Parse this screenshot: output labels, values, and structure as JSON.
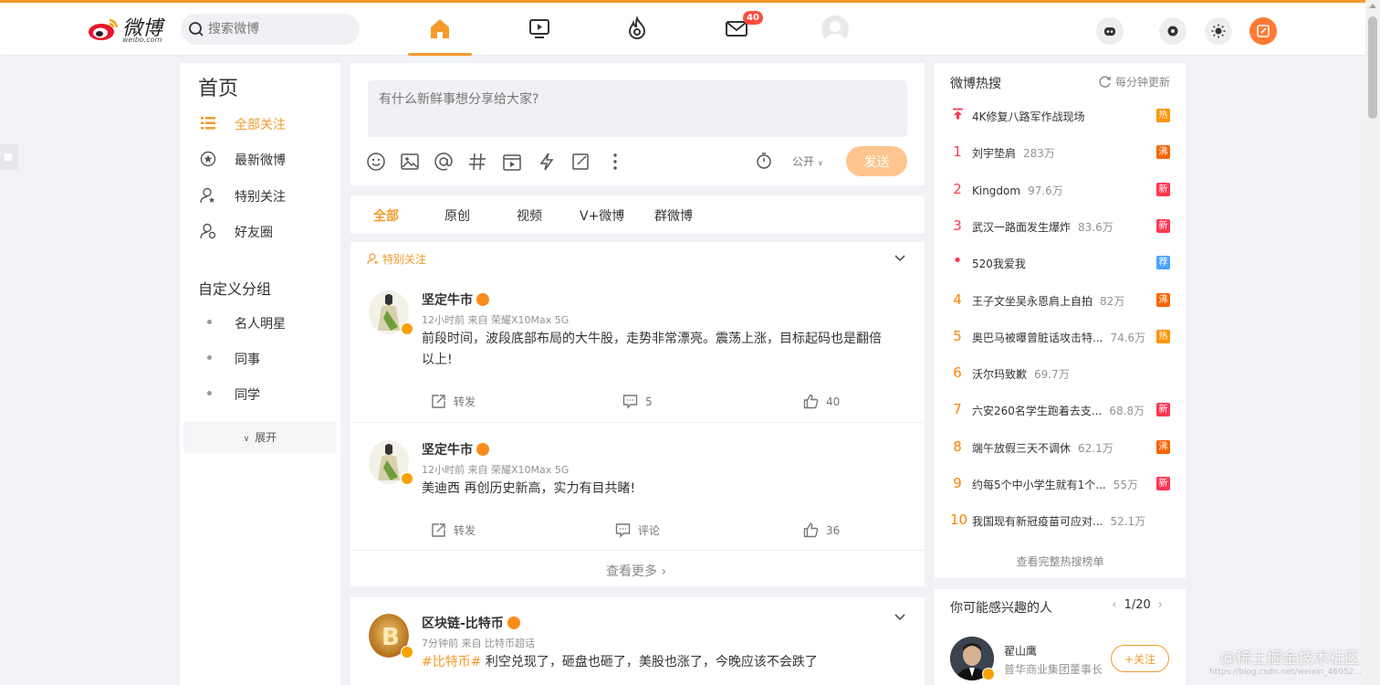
{
  "app": {
    "brand": "微博",
    "brand_url": "weibo.com"
  },
  "search": {
    "placeholder": "搜索微博"
  },
  "nav": {
    "items": [
      "home-icon",
      "video-icon",
      "hot-icon",
      "message-icon",
      "profile-avatar"
    ],
    "messages_badge": "40"
  },
  "sidebar": {
    "title": "首页",
    "items": [
      {
        "label": "全部关注",
        "icon": "list-icon"
      },
      {
        "label": "最新微博",
        "icon": "latest-icon"
      },
      {
        "label": "特别关注",
        "icon": "special-follow-icon"
      },
      {
        "label": "好友圈",
        "icon": "friends-icon"
      }
    ],
    "group_title": "自定义分组",
    "groups": [
      "名人明星",
      "同事",
      "同学"
    ],
    "expand_label": "展开"
  },
  "compose": {
    "placeholder": "有什么新鲜事想分享给大家?",
    "visibility": "公开",
    "send_label": "发送"
  },
  "tabs": [
    "全部",
    "原创",
    "视频",
    "V+微博",
    "群微博"
  ],
  "feed": {
    "header": "特别关注",
    "posts": [
      {
        "author": "坚定牛市",
        "meta": "12小时前  来自 荣耀X10Max 5G",
        "text": "前段时间，波段底部布局的大牛股，走势非常漂亮。震荡上涨，目标起码也是翻倍以上!",
        "repost": "转发",
        "comment": "5",
        "like": "40"
      },
      {
        "author": "坚定牛市",
        "meta": "12小时前  来自 荣耀X10Max 5G",
        "text": "美迪西 再创历史新高，实力有目共睹!",
        "repost": "转发",
        "comment": "评论",
        "like": "36"
      }
    ],
    "more_label": "查看更多 ›"
  },
  "feed2": {
    "author": "区块链-比特币",
    "meta": "7分钟前  来自 比特币超话",
    "hashtag": "#比特币#",
    "text": " 利空兑现了，砸盘也砸了，美股也涨了，今晚应该不会跌了"
  },
  "hot": {
    "title": "微博热搜",
    "refresh_label": "每分钟更新",
    "items": [
      {
        "rank": "",
        "text": "4K修复八路军作战现场",
        "count": "",
        "tag": "热",
        "tag_color": "#ff9406",
        "rank_icon": "top-arrow-icon"
      },
      {
        "rank": "1",
        "text": "刘宇垫肩",
        "count": "283万",
        "tag": "沸",
        "tag_color": "#f86400"
      },
      {
        "rank": "2",
        "text": "Kingdom",
        "count": "97.6万",
        "tag": "新",
        "tag_color": "#ff3852"
      },
      {
        "rank": "3",
        "text": "武汉一路面发生爆炸",
        "count": "83.6万",
        "tag": "新",
        "tag_color": "#ff3852"
      },
      {
        "rank": "•",
        "text": "520我爱我",
        "count": "",
        "tag": "荐",
        "tag_color": "#4aa3ff"
      },
      {
        "rank": "4",
        "text": "王子文坐吴永恩肩上自拍",
        "count": "82万",
        "tag": "沸",
        "tag_color": "#f86400"
      },
      {
        "rank": "5",
        "text": "奥巴马被曝曾脏话攻击特...",
        "count": "74.6万",
        "tag": "热",
        "tag_color": "#ff9406"
      },
      {
        "rank": "6",
        "text": "沃尔玛致歉",
        "count": "69.7万",
        "tag": "",
        "tag_color": ""
      },
      {
        "rank": "7",
        "text": "六安260名学生跑着去支...",
        "count": "68.8万",
        "tag": "新",
        "tag_color": "#ff3852"
      },
      {
        "rank": "8",
        "text": "端午放假三天不调休",
        "count": "62.1万",
        "tag": "沸",
        "tag_color": "#f86400"
      },
      {
        "rank": "9",
        "text": "约每5个中小学生就有1个...",
        "count": "55万",
        "tag": "新",
        "tag_color": "#ff3852"
      },
      {
        "rank": "10",
        "text": "我国现有新冠疫苗可应对...",
        "count": "52.1万",
        "tag": "",
        "tag_color": ""
      }
    ],
    "full_label": "查看完整热搜榜单"
  },
  "people": {
    "title": "你可能感兴趣的人",
    "pager": "1/20",
    "name": "翟山鹰",
    "desc": "普华商业集团董事长",
    "follow_label": "+关注"
  },
  "watermark": {
    "main": "@稀土掘金技术社区",
    "sub": "https://blog.csdn.net/weixin_46052..."
  },
  "colors": {
    "accent": "#f59a2b",
    "badge": "#ff4b3e"
  }
}
